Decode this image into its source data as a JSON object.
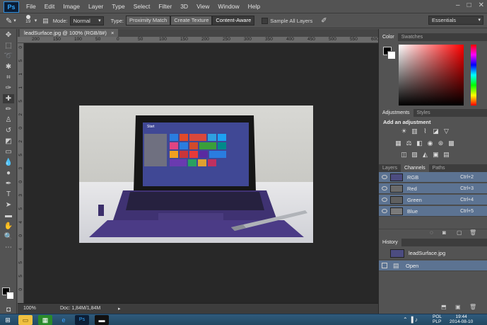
{
  "app": {
    "logo": "Ps"
  },
  "menu": [
    "File",
    "Edit",
    "Image",
    "Layer",
    "Type",
    "Select",
    "Filter",
    "3D",
    "View",
    "Window",
    "Help"
  ],
  "window_controls": [
    "–",
    "□",
    "✕"
  ],
  "options": {
    "brush_size": "19",
    "mode_label": "Mode:",
    "mode_value": "Normal",
    "type_label": "Type:",
    "types": [
      "Proximity Match",
      "Create Texture",
      "Content-Aware"
    ],
    "sample_all": "Sample All Layers",
    "workspace": "Essentials"
  },
  "document": {
    "tab": "leadSurface.jpg @ 100% (RGB/8#)",
    "close": "×",
    "ruler_h": [
      "200",
      "150",
      "100",
      "50",
      "0",
      "50",
      "100",
      "150",
      "200",
      "250",
      "300",
      "350",
      "400",
      "450",
      "500",
      "550",
      "600"
    ],
    "ruler_v": [
      "0",
      "5",
      "1",
      "1",
      "5",
      "2",
      "0",
      "2",
      "5",
      "3",
      "0",
      "3",
      "5",
      "4",
      "0",
      "4",
      "5",
      "5",
      "0"
    ],
    "image_start_label": "Start",
    "zoom": "100%",
    "doc_size": "Doc: 1,84M/1,84M"
  },
  "color_panel": {
    "tabs": [
      "Color",
      "Swatches"
    ]
  },
  "adjustments_panel": {
    "tabs": [
      "Adjustments",
      "Styles"
    ],
    "heading": "Add an adjustment"
  },
  "layers_panel": {
    "tabs": [
      "Layers",
      "Channels",
      "Paths"
    ],
    "channels": [
      {
        "name": "RGB",
        "shortcut": "Ctrl+2"
      },
      {
        "name": "Red",
        "shortcut": "Ctrl+3"
      },
      {
        "name": "Green",
        "shortcut": "Ctrl+4"
      },
      {
        "name": "Blue",
        "shortcut": "Ctrl+5"
      }
    ]
  },
  "history_panel": {
    "tabs": [
      "History"
    ],
    "snapshot": "leadSurface.jpg",
    "states": [
      "Open"
    ]
  },
  "taskbar": {
    "lang": "POL",
    "lang2": "PLP",
    "time": "19:44",
    "date": "2014-08-10"
  },
  "colors": {
    "accent_selected": "#5c7392",
    "photoshop_blue": "#31a8ff"
  }
}
